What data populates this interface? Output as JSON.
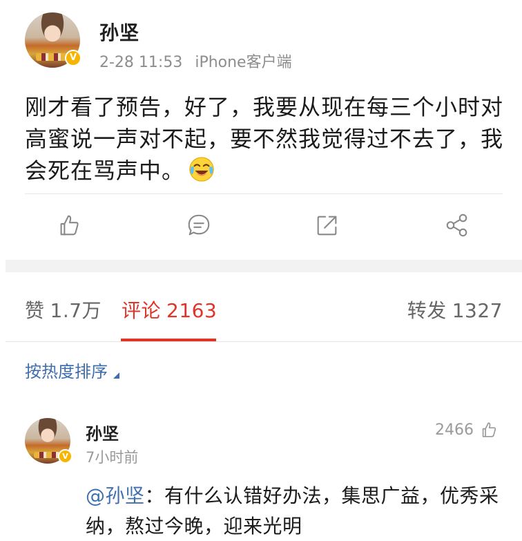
{
  "post": {
    "author": "孙坚",
    "timestamp": "2-28 11:53",
    "source": "iPhone客户端",
    "text": "刚才看了预告，好了，我要从现在每三个小时对高蜜说一声对不起，要不然我觉得过不去了，我会死在骂声中。",
    "emoji": "crying-laughing-emoji",
    "verified_badge": "V"
  },
  "actions": {
    "like": "thumbs-up-icon",
    "comment": "comment-bubble-icon",
    "repost": "repost-icon",
    "share": "share-icon"
  },
  "tabs": {
    "likes_label": "赞",
    "likes_count": "1.7万",
    "comments_label": "评论",
    "comments_count": "2163",
    "reposts_label": "转发",
    "reposts_count": "1327"
  },
  "sort": {
    "label": "按热度排序"
  },
  "comment": {
    "author": "孙坚",
    "time": "7小时前",
    "like_count": "2466",
    "mention": "@孙坚",
    "text": "：有什么认错好办法，集思广益，优秀采纳，熬过今晚，迎来光明",
    "verified_badge": "V"
  },
  "colors": {
    "accent_red": "#e0342a",
    "link_blue": "#3f6fae",
    "verified_yellow": "#f7b500"
  }
}
